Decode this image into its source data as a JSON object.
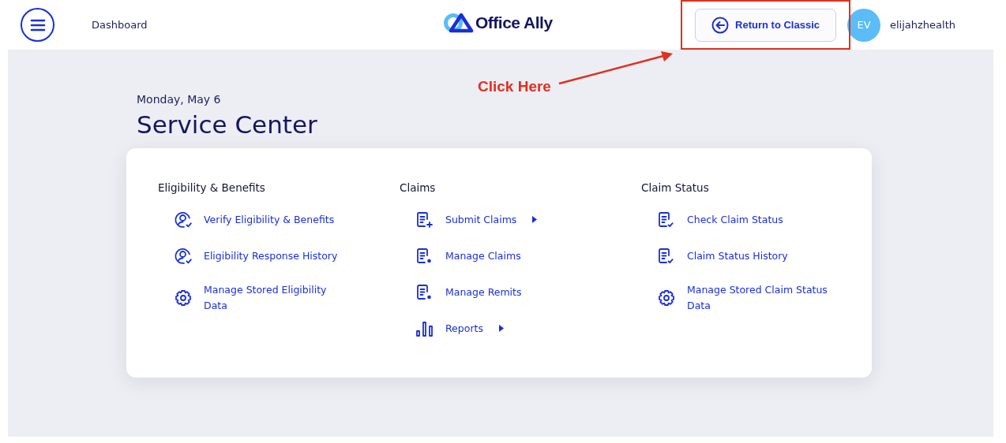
{
  "header": {
    "nav_link": "Dashboard",
    "logo_text": "Office Ally",
    "return_button": "Return to Classic",
    "avatar_initials": "EV",
    "username": "elijahzhealth"
  },
  "annotation": {
    "label": "Click Here"
  },
  "page": {
    "date": "Monday, May 6",
    "title": "Service Center"
  },
  "sections": [
    {
      "title": "Eligibility & Benefits",
      "items": [
        {
          "label": "Verify Eligibility & Benefits",
          "kind": "person-check",
          "has_submenu": false
        },
        {
          "label": "Eligibility Response History",
          "kind": "person-check",
          "has_submenu": false
        },
        {
          "label": "Manage Stored Eligibility Data",
          "kind": "gear",
          "has_submenu": false
        }
      ]
    },
    {
      "title": "Claims",
      "items": [
        {
          "label": "Submit Claims",
          "kind": "doc-plus",
          "has_submenu": true
        },
        {
          "label": "Manage Claims",
          "kind": "doc-gear",
          "has_submenu": false
        },
        {
          "label": "Manage Remits",
          "kind": "doc-gear",
          "has_submenu": false
        },
        {
          "label": "Reports",
          "kind": "bars",
          "has_submenu": true
        }
      ]
    },
    {
      "title": "Claim Status",
      "items": [
        {
          "label": "Check Claim Status",
          "kind": "doc-check",
          "has_submenu": false
        },
        {
          "label": "Claim Status History",
          "kind": "doc-check",
          "has_submenu": false
        },
        {
          "label": "Manage Stored Claim Status Data",
          "kind": "gear",
          "has_submenu": false
        }
      ]
    }
  ]
}
